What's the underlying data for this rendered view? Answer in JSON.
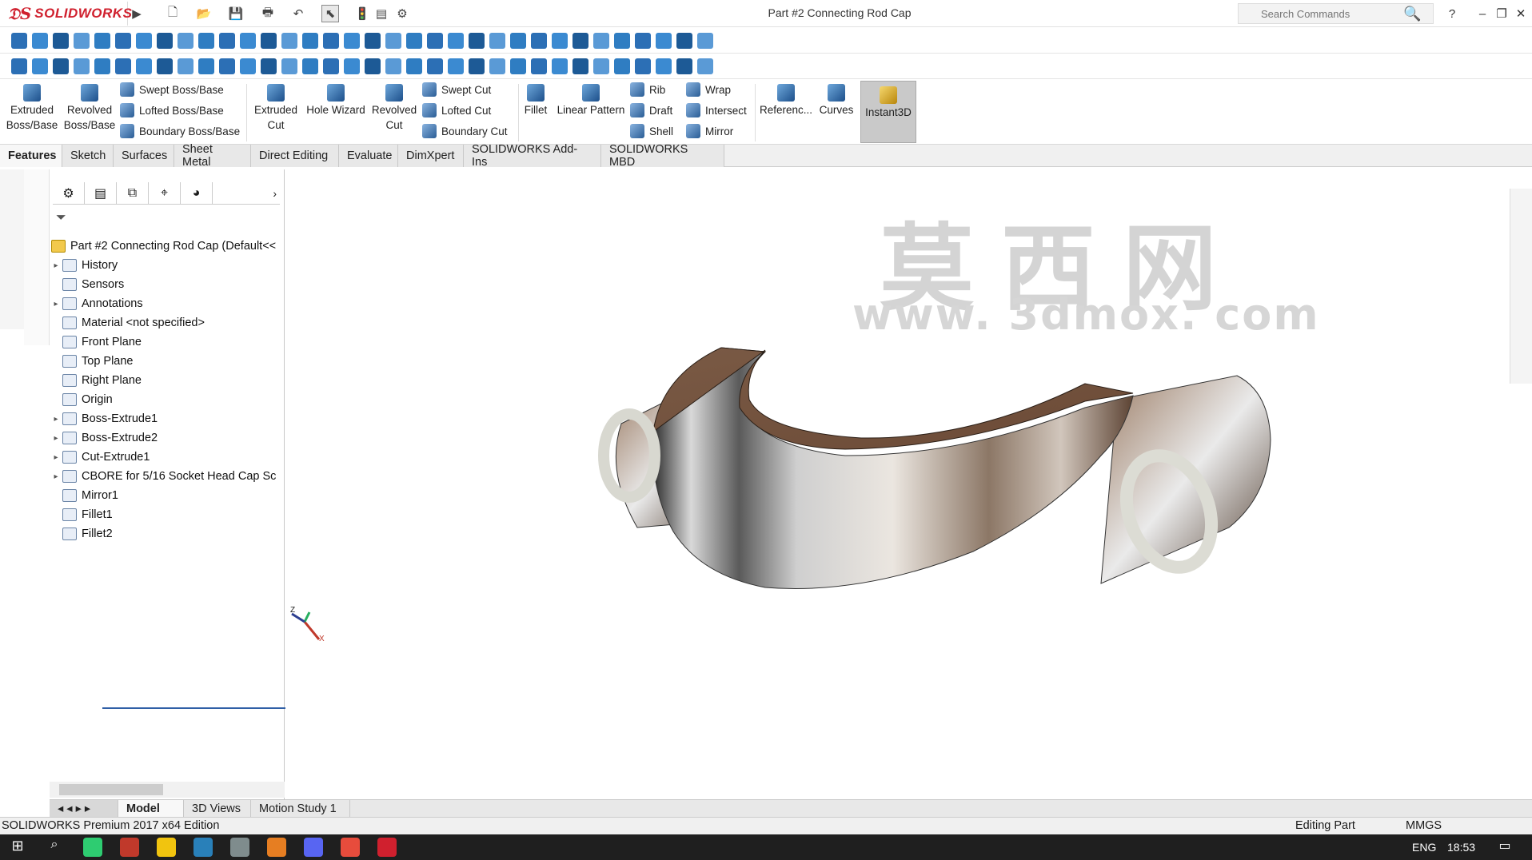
{
  "app": {
    "name": "SOLIDWORKS",
    "window_title": "Part #2 Connecting Rod Cap"
  },
  "search": {
    "placeholder": "Search Commands"
  },
  "ribbon": {
    "extruded_boss": "Extruded Boss/Base",
    "revolved_boss": "Revolved Boss/Base",
    "swept_boss": "Swept Boss/Base",
    "lofted_boss": "Lofted Boss/Base",
    "boundary_boss": "Boundary Boss/Base",
    "extruded_cut": "Extruded Cut",
    "hole_wizard": "Hole Wizard",
    "revolved_cut": "Revolved Cut",
    "swept_cut": "Swept Cut",
    "lofted_cut": "Lofted Cut",
    "boundary_cut": "Boundary Cut",
    "fillet": "Fillet",
    "linear_pattern": "Linear Pattern",
    "rib": "Rib",
    "draft": "Draft",
    "shell": "Shell",
    "wrap": "Wrap",
    "intersect": "Intersect",
    "mirror": "Mirror",
    "reference": "Referenc...",
    "curves": "Curves",
    "instant3d": "Instant3D"
  },
  "tabs": [
    "Features",
    "Sketch",
    "Surfaces",
    "Sheet Metal",
    "Direct Editing",
    "Evaluate",
    "DimXpert",
    "SOLIDWORKS Add-Ins",
    "SOLIDWORKS MBD"
  ],
  "tree": {
    "root": "Part #2 Connecting Rod Cap  (Default<<",
    "items": [
      {
        "label": "History",
        "expandable": true
      },
      {
        "label": "Sensors",
        "expandable": false
      },
      {
        "label": "Annotations",
        "expandable": true
      },
      {
        "label": "Material <not specified>",
        "expandable": false
      },
      {
        "label": "Front Plane",
        "expandable": false
      },
      {
        "label": "Top Plane",
        "expandable": false
      },
      {
        "label": "Right Plane",
        "expandable": false
      },
      {
        "label": "Origin",
        "expandable": false
      },
      {
        "label": "Boss-Extrude1",
        "expandable": true
      },
      {
        "label": "Boss-Extrude2",
        "expandable": true
      },
      {
        "label": "Cut-Extrude1",
        "expandable": true
      },
      {
        "label": "CBORE for 5/16 Socket Head Cap Sc",
        "expandable": true
      },
      {
        "label": "Mirror1",
        "expandable": false
      },
      {
        "label": "Fillet1",
        "expandable": false
      },
      {
        "label": "Fillet2",
        "expandable": false
      }
    ]
  },
  "watermark": {
    "cn": "莫西网",
    "url": "www. 3dmox. com"
  },
  "triad": {
    "z": "Z",
    "x": "X"
  },
  "bottom_tabs": [
    "Model",
    "3D Views",
    "Motion Study 1"
  ],
  "status": {
    "edition": "SOLIDWORKS Premium 2017 x64 Edition",
    "mode": "Editing Part",
    "units": "MMGS"
  },
  "taskbar": {
    "lang": "ENG",
    "time": "18:53"
  }
}
